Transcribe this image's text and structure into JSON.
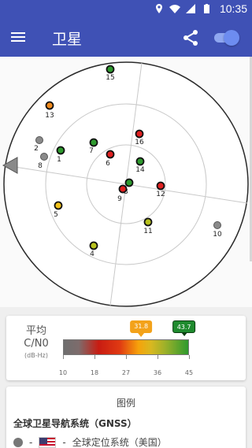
{
  "status_bar": {
    "time": "10:35",
    "icons": [
      "location-icon",
      "wifi-icon",
      "signal-icon",
      "battery-icon"
    ]
  },
  "app_bar": {
    "title": "卫星",
    "menu_icon": "menu-icon",
    "share_icon": "share-icon",
    "toggle_on": true
  },
  "sky_plot": {
    "direction_marker": "bearing-arrow",
    "satellites": [
      {
        "id": "15",
        "color": "green",
        "elevation": 0.06,
        "azimuth_deg": 0
      },
      {
        "id": "13",
        "color": "orange",
        "elevation": 0.0,
        "azimuth_deg": 0
      },
      {
        "id": "2",
        "color": "gray"
      },
      {
        "id": "8",
        "color": "gray"
      },
      {
        "id": "1",
        "color": "green"
      },
      {
        "id": "7",
        "color": "green"
      },
      {
        "id": "16",
        "color": "red"
      },
      {
        "id": "6",
        "color": "red"
      },
      {
        "id": "14",
        "color": "green"
      },
      {
        "id": "3",
        "color": "green"
      },
      {
        "id": "9",
        "color": "red"
      },
      {
        "id": "12",
        "color": "red"
      },
      {
        "id": "5",
        "color": "yellow"
      },
      {
        "id": "11",
        "color": "yellow-green"
      },
      {
        "id": "10",
        "color": "gray"
      },
      {
        "id": "4",
        "color": "yellow-green"
      }
    ],
    "colors": {
      "green": "#2e9a2e",
      "orange": "#f08a1c",
      "gray": "#8a8a8a",
      "red": "#e02020",
      "yellow": "#f2c21a",
      "yellow-green": "#b8c21e"
    }
  },
  "cn0": {
    "title_line1": "平均",
    "title_line2": "C/N0",
    "unit": "(dB-Hz)",
    "avg_value": "31.8",
    "max_value": "43.7",
    "avg_fraction": 0.62,
    "max_fraction": 0.96,
    "ticks": [
      "10",
      "18",
      "27",
      "36",
      "45"
    ]
  },
  "legend": {
    "title": "图例",
    "gnss_heading": "全球卫星导航系统（GNSS）",
    "row_dash1": "-",
    "row_dash2": "-",
    "row_label": "全球定位系统（美国）"
  }
}
